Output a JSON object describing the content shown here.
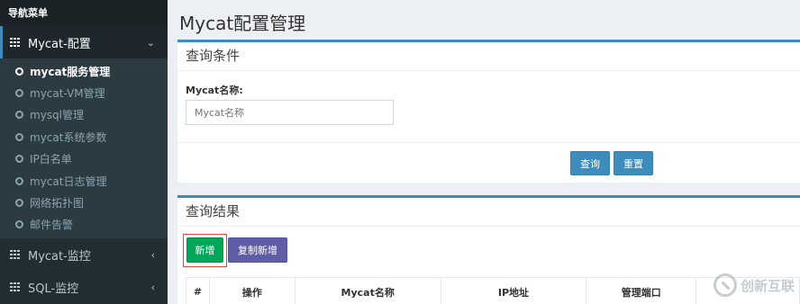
{
  "sidebar": {
    "header": "导航菜单",
    "groups": [
      {
        "label": "Mycat-配置",
        "icon": "grid-icon",
        "chevron": "chevron-down-icon",
        "items": [
          {
            "label": "mycat服务管理",
            "active": true
          },
          {
            "label": "mycat-VM管理"
          },
          {
            "label": "mysql管理"
          },
          {
            "label": "mycat系统参数"
          },
          {
            "label": "IP白名单"
          },
          {
            "label": "mycat日志管理"
          },
          {
            "label": "网络拓扑图"
          },
          {
            "label": "邮件告警"
          }
        ]
      },
      {
        "label": "Mycat-监控",
        "icon": "grid-icon",
        "chevron": "chevron-left-icon"
      },
      {
        "label": "SQL-监控",
        "icon": "grid-icon",
        "chevron": "chevron-left-icon"
      }
    ]
  },
  "main": {
    "title": "Mycat配置管理",
    "query_box": {
      "title": "查询条件",
      "field_label": "Mycat名称:",
      "field_placeholder": "Mycat名称",
      "query_button": "查询",
      "reset_button": "重置"
    },
    "result_box": {
      "title": "查询结果",
      "add_button": "新增",
      "copy_button": "复制新增",
      "columns": [
        "#",
        "操作",
        "Mycat名称",
        "IP地址",
        "管理端口",
        ""
      ]
    }
  },
  "watermark": "创新互联",
  "colors": {
    "primary": "#3c8dbc",
    "success": "#00a65a",
    "purple": "#605ca8",
    "sidebar_bg": "#222d32"
  }
}
